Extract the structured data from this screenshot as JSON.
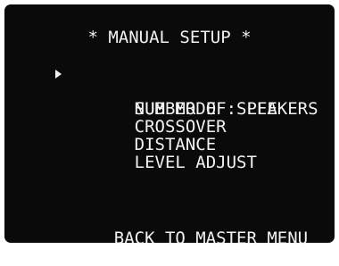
{
  "screen": {
    "title": "* MANUAL SETUP *",
    "menu_items": [
      {
        "label": "NUMBER OF SPEAKERS",
        "selected": true
      },
      {
        "label": "SUB MODE : LFE",
        "selected": false
      },
      {
        "label": "CROSSOVER",
        "selected": false
      },
      {
        "label": "DISTANCE",
        "selected": false
      },
      {
        "label": "LEVEL ADJUST",
        "selected": false
      }
    ],
    "back_label": "BACK TO MASTER MENU",
    "cursor_icon": "triangle-right-icon"
  },
  "colors": {
    "background": "#0a0a0a",
    "text": "#f2f2f2"
  }
}
